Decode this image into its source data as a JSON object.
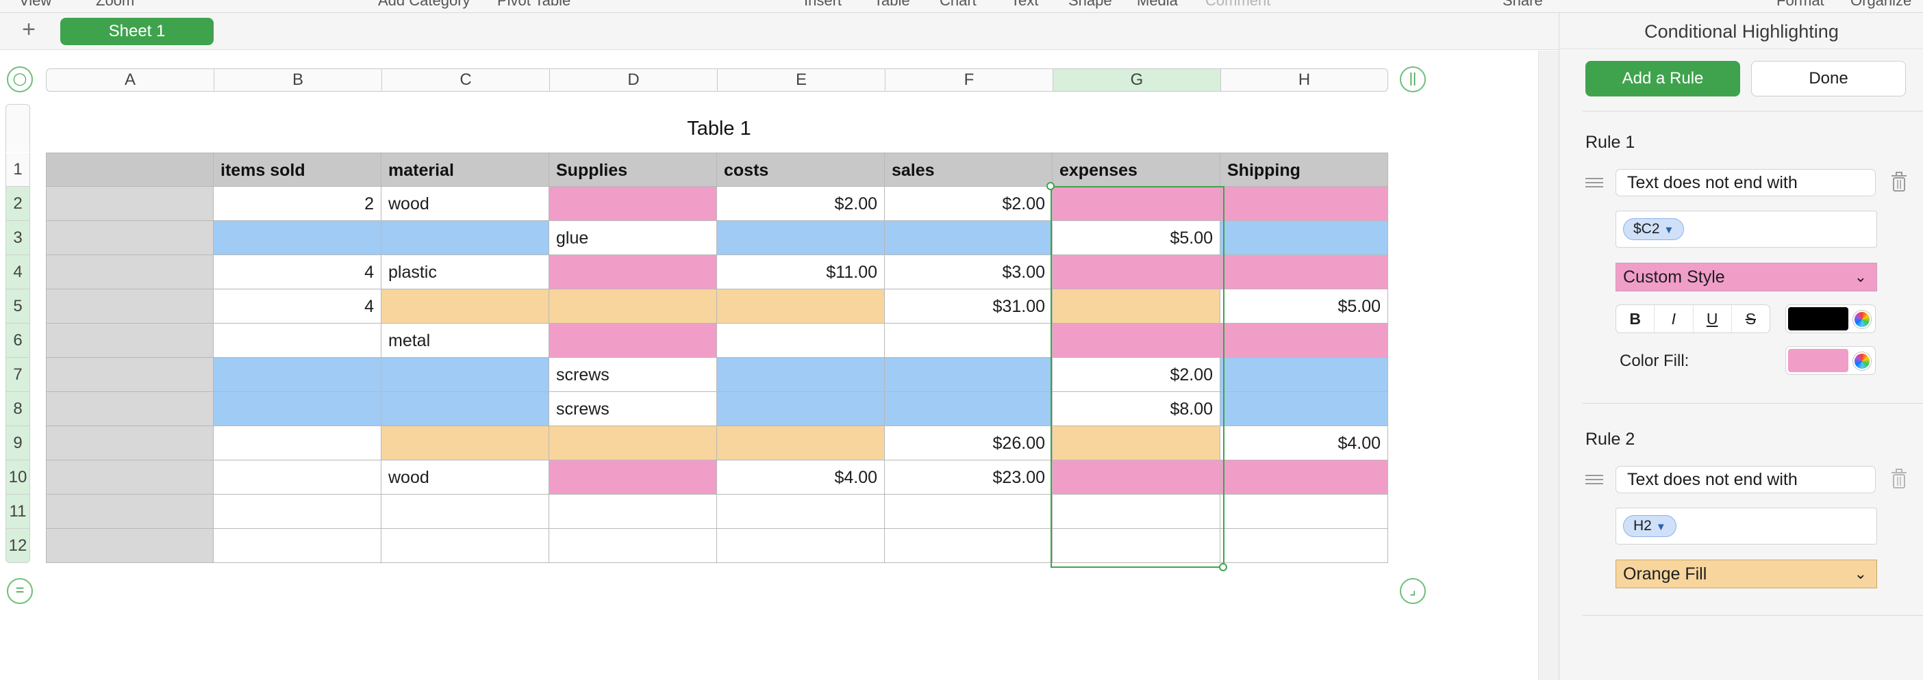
{
  "toolbar": {
    "items": [
      "View",
      "Zoom",
      "Add Category",
      "Pivot Table",
      "Insert",
      "Table",
      "Chart",
      "Text",
      "Shape",
      "Media",
      "Comment",
      "Share",
      "Format",
      "Organize"
    ]
  },
  "tabs": {
    "add_icon": "+",
    "sheet": "Sheet 1"
  },
  "colors": {
    "accent": "#3fa34d",
    "pink": "#f09ec8",
    "blue": "#9fcbf5",
    "orange": "#f7d59c",
    "header_gray": "#c8c8c8"
  },
  "table": {
    "title": "Table 1",
    "column_letters": [
      "A",
      "B",
      "C",
      "D",
      "E",
      "F",
      "G",
      "H"
    ],
    "selected_column": "G",
    "row_numbers": [
      "1",
      "2",
      "3",
      "4",
      "5",
      "6",
      "7",
      "8",
      "9",
      "10",
      "11",
      "12"
    ],
    "headers": [
      "",
      "items sold",
      "material",
      "Supplies",
      "costs",
      "sales",
      "expenses",
      "Shipping"
    ],
    "rows": [
      {
        "cells": [
          "",
          "2",
          "wood",
          "",
          "$2.00",
          "$2.00",
          "",
          ""
        ],
        "fills": [
          "gray",
          "white",
          "white",
          "pink",
          "white",
          "white",
          "pink",
          "pink"
        ]
      },
      {
        "cells": [
          "",
          "",
          "",
          "glue",
          "",
          "",
          "$5.00",
          ""
        ],
        "fills": [
          "gray",
          "blue",
          "blue",
          "white",
          "blue",
          "blue",
          "white",
          "blue"
        ]
      },
      {
        "cells": [
          "",
          "4",
          "plastic",
          "",
          "$11.00",
          "$3.00",
          "",
          ""
        ],
        "fills": [
          "gray",
          "white",
          "white",
          "pink",
          "white",
          "white",
          "pink",
          "pink"
        ]
      },
      {
        "cells": [
          "",
          "4",
          "",
          "",
          "",
          "$31.00",
          "",
          "$5.00"
        ],
        "fills": [
          "gray",
          "white",
          "orange",
          "orange",
          "orange",
          "white",
          "orange",
          "white"
        ]
      },
      {
        "cells": [
          "",
          "",
          "metal",
          "",
          "",
          "",
          "",
          ""
        ],
        "fills": [
          "gray",
          "white",
          "white",
          "pink",
          "white",
          "white",
          "pink",
          "pink"
        ]
      },
      {
        "cells": [
          "",
          "",
          "",
          "screws",
          "",
          "",
          "$2.00",
          ""
        ],
        "fills": [
          "gray",
          "blue",
          "blue",
          "white",
          "blue",
          "blue",
          "white",
          "blue"
        ]
      },
      {
        "cells": [
          "",
          "",
          "",
          "screws",
          "",
          "",
          "$8.00",
          ""
        ],
        "fills": [
          "gray",
          "blue",
          "blue",
          "white",
          "blue",
          "blue",
          "white",
          "blue"
        ]
      },
      {
        "cells": [
          "",
          "",
          "",
          "",
          "",
          "$26.00",
          "",
          "$4.00"
        ],
        "fills": [
          "gray",
          "white",
          "orange",
          "orange",
          "orange",
          "white",
          "orange",
          "white"
        ]
      },
      {
        "cells": [
          "",
          "",
          "wood",
          "",
          "$4.00",
          "$23.00",
          "",
          ""
        ],
        "fills": [
          "gray",
          "white",
          "white",
          "pink",
          "white",
          "white",
          "pink",
          "pink"
        ]
      },
      {
        "cells": [
          "",
          "",
          "",
          "",
          "",
          "",
          "",
          ""
        ],
        "fills": [
          "gray",
          "white",
          "white",
          "white",
          "white",
          "white",
          "white",
          "white"
        ]
      },
      {
        "cells": [
          "",
          "",
          "",
          "",
          "",
          "",
          "",
          ""
        ],
        "fills": [
          "gray",
          "white",
          "white",
          "white",
          "white",
          "white",
          "white",
          "white"
        ]
      }
    ]
  },
  "inspector": {
    "title": "Conditional Highlighting",
    "add_rule": "Add a Rule",
    "done": "Done",
    "rule1": {
      "title": "Rule 1",
      "condition": "Text does not end with",
      "reference": "$C2",
      "style": "Custom Style",
      "bold": "B",
      "italic": "I",
      "underline": "U",
      "strike": "S",
      "text_color": "#000000",
      "fill_label": "Color Fill:",
      "fill_color": "#f09ec8"
    },
    "rule2": {
      "title": "Rule 2",
      "condition": "Text does not end with",
      "reference": "H2",
      "style": "Orange Fill"
    }
  }
}
